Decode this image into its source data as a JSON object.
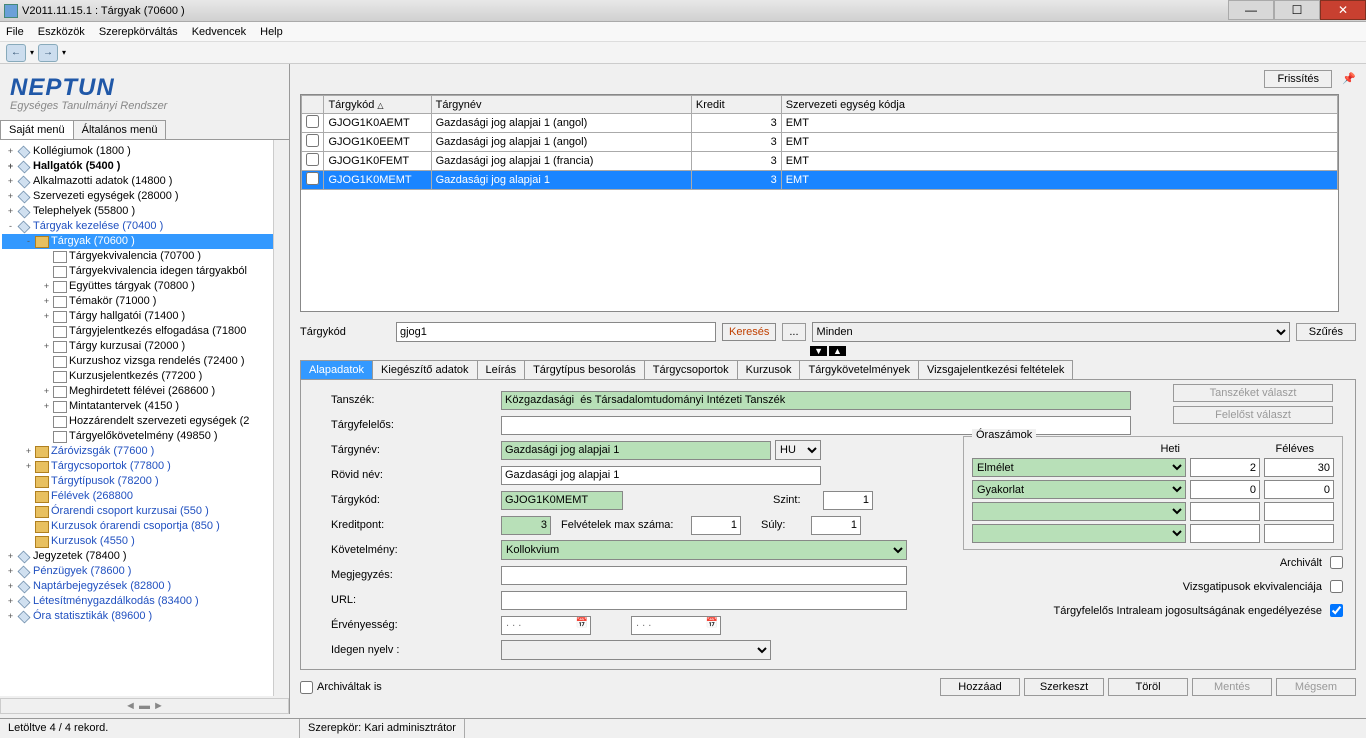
{
  "title": "V2011.11.15.1 : Tárgyak (70600 )",
  "menu": [
    "File",
    "Eszközök",
    "Szerepkörváltás",
    "Kedvencek",
    "Help"
  ],
  "logo": {
    "main": "NEPTUN",
    "sub": "Egységes Tanulmányi Rendszer"
  },
  "ltabs": [
    "Saját menü",
    "Általános menü"
  ],
  "tree": [
    {
      "d": 0,
      "e": "+",
      "i": "diamond",
      "t": "Kollégiumok (1800 )"
    },
    {
      "d": 0,
      "e": "+",
      "i": "diamond",
      "t": "Hallgatók (5400  )",
      "bold": true
    },
    {
      "d": 0,
      "e": "+",
      "i": "diamond",
      "t": "Alkalmazotti adatok (14800 )"
    },
    {
      "d": 0,
      "e": "+",
      "i": "diamond",
      "t": "Szervezeti egységek (28000 )"
    },
    {
      "d": 0,
      "e": "+",
      "i": "diamond",
      "t": "Telephelyek (55800 )"
    },
    {
      "d": 0,
      "e": "-",
      "i": "diamond",
      "t": "Tárgyak kezelése (70400 )",
      "link": true
    },
    {
      "d": 1,
      "e": "-",
      "i": "folder",
      "t": "Tárgyak (70600  )",
      "sel": true,
      "link": true
    },
    {
      "d": 2,
      "e": " ",
      "i": "page",
      "t": "Tárgyekvivalencia (70700 )"
    },
    {
      "d": 2,
      "e": " ",
      "i": "page",
      "t": "Tárgyekvivalencia idegen tárgyakból "
    },
    {
      "d": 2,
      "e": "+",
      "i": "page",
      "t": "Együttes tárgyak (70800 )"
    },
    {
      "d": 2,
      "e": "+",
      "i": "page",
      "t": "Témakör (71000 )"
    },
    {
      "d": 2,
      "e": "+",
      "i": "page",
      "t": "Tárgy hallgatói (71400 )"
    },
    {
      "d": 2,
      "e": " ",
      "i": "page",
      "t": "Tárgyjelentkezés elfogadása (71800 "
    },
    {
      "d": 2,
      "e": "+",
      "i": "page",
      "t": "Tárgy kurzusai (72000 )"
    },
    {
      "d": 2,
      "e": " ",
      "i": "page",
      "t": "Kurzushoz vizsga rendelés (72400 )"
    },
    {
      "d": 2,
      "e": " ",
      "i": "page",
      "t": "Kurzusjelentkezés (77200 )"
    },
    {
      "d": 2,
      "e": "+",
      "i": "page",
      "t": "Meghirdetett félévei (268600 )"
    },
    {
      "d": 2,
      "e": "+",
      "i": "page",
      "t": "Mintatantervek (4150 )"
    },
    {
      "d": 2,
      "e": " ",
      "i": "page",
      "t": "Hozzárendelt szervezeti egységek (2"
    },
    {
      "d": 2,
      "e": " ",
      "i": "page",
      "t": "Tárgyelőkövetelmény (49850 )"
    },
    {
      "d": 1,
      "e": "+",
      "i": "folder",
      "t": "Záróvizsgák (77600 )",
      "link": true
    },
    {
      "d": 1,
      "e": "+",
      "i": "folder",
      "t": "Tárgycsoportok (77800 )",
      "link": true
    },
    {
      "d": 1,
      "e": " ",
      "i": "folder",
      "t": "Tárgytípusok (78200 )",
      "link": true
    },
    {
      "d": 1,
      "e": " ",
      "i": "folder",
      "t": "Félévek (268800",
      "link": true
    },
    {
      "d": 1,
      "e": " ",
      "i": "folder",
      "t": "Órarendi csoport kurzusai (550 )",
      "link": true
    },
    {
      "d": 1,
      "e": " ",
      "i": "folder",
      "t": "Kurzusok órarendi csoportja (850 )",
      "link": true
    },
    {
      "d": 1,
      "e": " ",
      "i": "folder",
      "t": "Kurzusok (4550 )",
      "link": true
    },
    {
      "d": 0,
      "e": "+",
      "i": "diamond",
      "t": "Jegyzetek (78400 )"
    },
    {
      "d": 0,
      "e": "+",
      "i": "diamond",
      "t": "Pénzügyek (78600 )",
      "link": true
    },
    {
      "d": 0,
      "e": "+",
      "i": "diamond",
      "t": "Naptárbejegyzések (82800 )",
      "link": true
    },
    {
      "d": 0,
      "e": "+",
      "i": "diamond",
      "t": "Létesítménygazdálkodás (83400 )",
      "link": true
    },
    {
      "d": 0,
      "e": "+",
      "i": "diamond",
      "t": "Óra statisztikák (89600 )",
      "link": true
    }
  ],
  "refresh": "Frissítés",
  "grid_headers": [
    "",
    "Tárgykód",
    "Tárgynév",
    "Kredit",
    "Szervezeti egység kódja"
  ],
  "grid_rows": [
    {
      "kod": "GJOG1K0AEMT",
      "nev": "Gazdasági jog alapjai 1 (angol)",
      "kr": "3",
      "sz": "EMT"
    },
    {
      "kod": "GJOG1K0EEMT",
      "nev": "Gazdasági jog alapjai 1 (angol)",
      "kr": "3",
      "sz": "EMT"
    },
    {
      "kod": "GJOG1K0FEMT",
      "nev": "Gazdasági jog alapjai 1 (francia)",
      "kr": "3",
      "sz": "EMT"
    },
    {
      "kod": "GJOG1K0MEMT",
      "nev": "Gazdasági jog alapjai 1",
      "kr": "3",
      "sz": "EMT",
      "sel": true
    }
  ],
  "search": {
    "label": "Tárgykód",
    "value": "gjog1",
    "btn": "Keresés",
    "dots": "...",
    "filter": "Minden",
    "szures": "Szűrés"
  },
  "dtabs": [
    "Alapadatok",
    "Kiegészítő adatok",
    "Leírás",
    "Tárgytípus besorolás",
    "Tárgycsoportok",
    "Kurzusok",
    "Tárgykövetelmények",
    "Vizsgajelentkezési feltételek"
  ],
  "form": {
    "tanszek_l": "Tanszék:",
    "tanszek_v": "Közgazdasági  és Társadalomtudományi Intézeti Tanszék",
    "felelos_l": "Tárgyfelelős:",
    "felelos_v": "",
    "nev_l": "Tárgynév:",
    "nev_v": "Gazdasági jog alapjai 1",
    "nev_lang": "HU",
    "rovid_l": "Rövid név:",
    "rovid_v": "Gazdasági jog alapjai 1",
    "kod_l": "Tárgykód:",
    "kod_v": "GJOG1K0MEMT",
    "szint_l": "Szint:",
    "szint_v": "1",
    "kredit_l": "Kreditpont:",
    "kredit_v": "3",
    "felvmax_l": "Felvételek max száma:",
    "felvmax_v": "1",
    "suly_l": "Súly:",
    "suly_v": "1",
    "kov_l": "Követelmény:",
    "kov_v": "Kollokvium",
    "megj_l": "Megjegyzés:",
    "megj_v": "",
    "url_l": "URL:",
    "url_v": "",
    "erv_l": "Érvényesség:",
    "erv_v": ".  .  .",
    "idegen_l": "Idegen nyelv :",
    "idegen_v": "",
    "btn_tanszek": "Tanszéket választ",
    "btn_felelos": "Felelőst választ",
    "ora_title": "Óraszámok",
    "ora_heti": "Heti",
    "ora_feleves": "Féléves",
    "ora_rows": [
      {
        "t": "Elmélet",
        "h": "2",
        "f": "30"
      },
      {
        "t": "Gyakorlat",
        "h": "0",
        "f": "0"
      },
      {
        "t": "",
        "h": "",
        "f": ""
      },
      {
        "t": "",
        "h": "",
        "f": ""
      }
    ],
    "chk1": "Archivált",
    "chk2": "Vizsgatipusok ekvivalenciája",
    "chk3": "Tárgyfelelős Intraleam jogosultságának engedélyezése",
    "chk3v": true
  },
  "archivaltak": "Archiváltak is",
  "buttons": {
    "add": "Hozzáad",
    "edit": "Szerkeszt",
    "del": "Töröl",
    "save": "Mentés",
    "cancel": "Mégsem"
  },
  "status": {
    "left": "Letöltve 4 / 4 rekord.",
    "right": "Szerepkör: Kari adminisztrátor"
  }
}
